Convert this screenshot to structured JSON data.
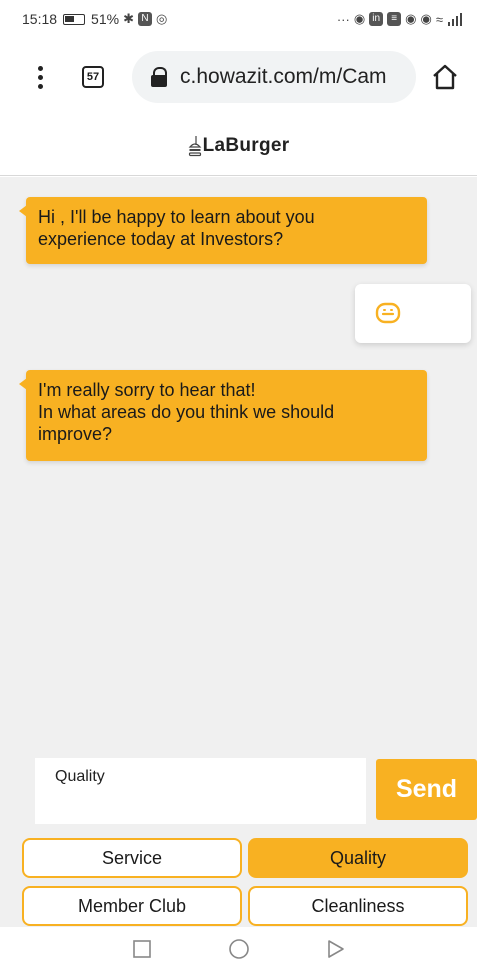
{
  "status_bar": {
    "time": "15:18",
    "battery": "51%",
    "glyphs": "···"
  },
  "browser": {
    "tab_count": "57",
    "url": "c.howazit.com/m/Cam"
  },
  "header": {
    "logo_text": "LaBurger"
  },
  "chat": {
    "messages": [
      {
        "lines": [
          "Hi , I'll be happy to learn about you",
          "experience today at Investors?"
        ]
      },
      {
        "lines": [
          "I'm really sorry to hear that!",
          "In what areas do you think we should",
          "improve?"
        ]
      }
    ]
  },
  "composer": {
    "input_value": "Quality",
    "send_label": "Send"
  },
  "quick_replies": [
    {
      "label": "Service",
      "selected": false
    },
    {
      "label": "Quality",
      "selected": true
    },
    {
      "label": "Member Club",
      "selected": false
    },
    {
      "label": "Cleanliness",
      "selected": false
    }
  ],
  "colors": {
    "accent": "#f8b122",
    "chat_background": "#f0f0f0"
  },
  "icons": [
    "menu-dots-icon",
    "tab-switcher-icon",
    "lock-icon",
    "home-icon",
    "typing-emoji-icon",
    "recent-apps-icon",
    "home-nav-icon",
    "back-nav-icon"
  ]
}
